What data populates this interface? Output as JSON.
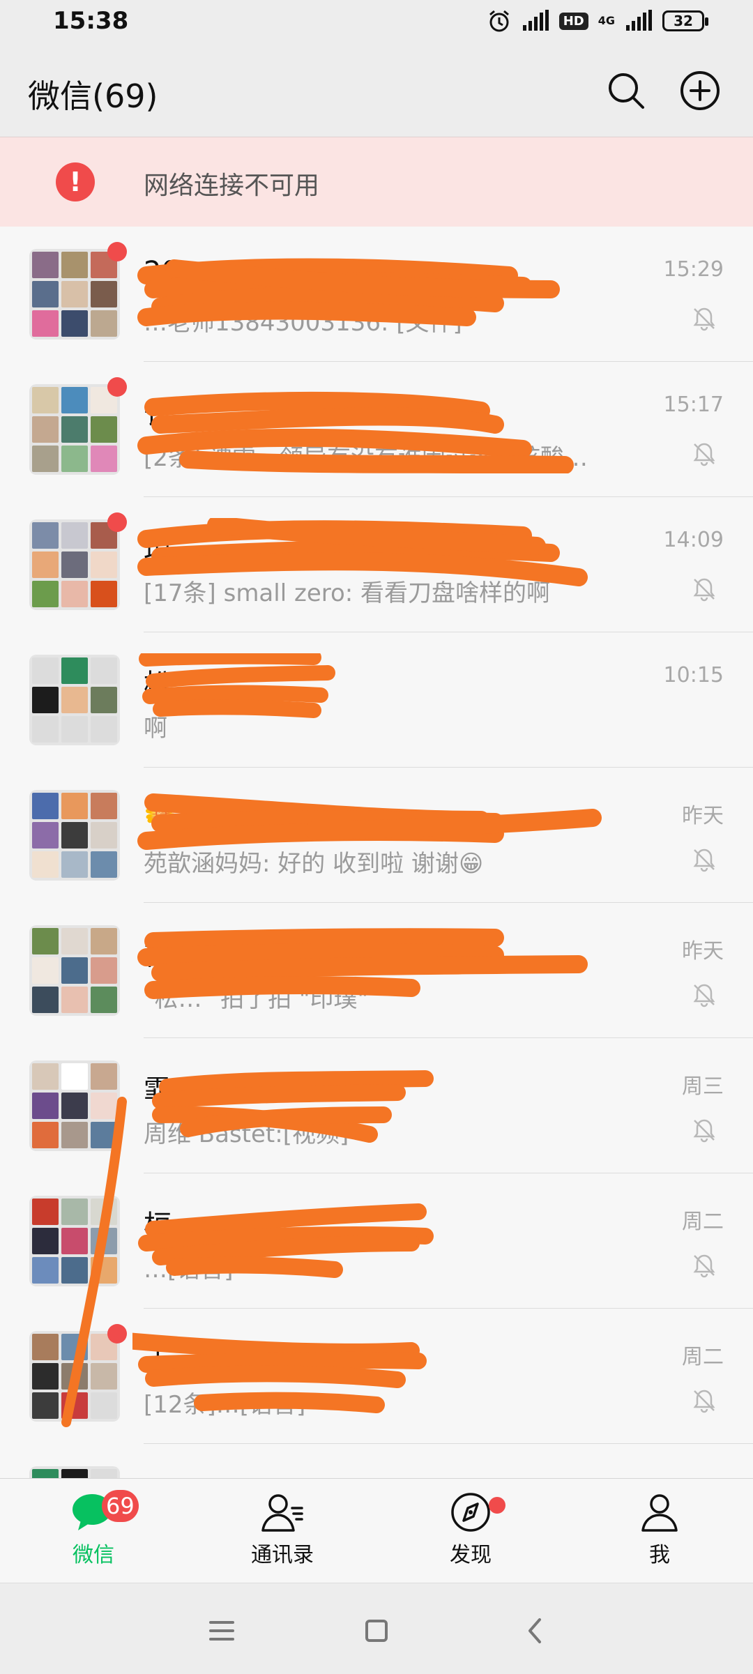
{
  "status_bar": {
    "time": "15:38",
    "network": "4G",
    "hd": "HD",
    "battery": "32"
  },
  "header": {
    "title": "微信(69)"
  },
  "network_warning": {
    "icon": "!",
    "text": "网络连接不可用"
  },
  "chats": [
    {
      "name": "20",
      "message": "…老师13843003136: [文件]",
      "time": "15:29",
      "muted": true,
      "unread_dot": true
    },
    {
      "name": "长",
      "message": "[2条] 谭雪…领导有没有谁因过这种核酸…",
      "time": "15:17",
      "muted": true,
      "unread_dot": true
    },
    {
      "name": "琼",
      "message": "[17条] small zero: 看看刀盘啥样的啊",
      "time": "14:09",
      "muted": true,
      "unread_dot": true
    },
    {
      "name": "松",
      "message": "啊",
      "time": "10:15",
      "muted": false,
      "unread_dot": false
    },
    {
      "name": "🌼",
      "message": "苑歆涵妈妈: 好的 收到啦 谢谢😁",
      "time": "昨天",
      "muted": true,
      "unread_dot": false
    },
    {
      "name": "吉",
      "message": "\"松…\" 拍了拍 \"印璞\"",
      "time": "昨天",
      "muted": true,
      "unread_dot": false
    },
    {
      "name": "霏",
      "message": "周维 Bastet:[视频]",
      "time": "周三",
      "muted": true,
      "unread_dot": false
    },
    {
      "name": "桓",
      "message": "…[语音]",
      "time": "周二",
      "muted": true,
      "unread_dot": false
    },
    {
      "name": "于",
      "message": "[12条]…[语音]",
      "time": "周二",
      "muted": true,
      "unread_dot": true
    }
  ],
  "tabs": [
    {
      "label": "微信",
      "icon": "chat-bubble-icon",
      "badge": "69",
      "active": true
    },
    {
      "label": "通讯录",
      "icon": "contacts-icon",
      "active": false
    },
    {
      "label": "发现",
      "icon": "compass-icon",
      "dot": true,
      "active": false
    },
    {
      "label": "我",
      "icon": "person-icon",
      "active": false
    }
  ],
  "colors": {
    "accent": "#07c160",
    "badge": "#f04b4b",
    "scribble": "#f47524",
    "warning_bg": "#fbe4e3"
  }
}
